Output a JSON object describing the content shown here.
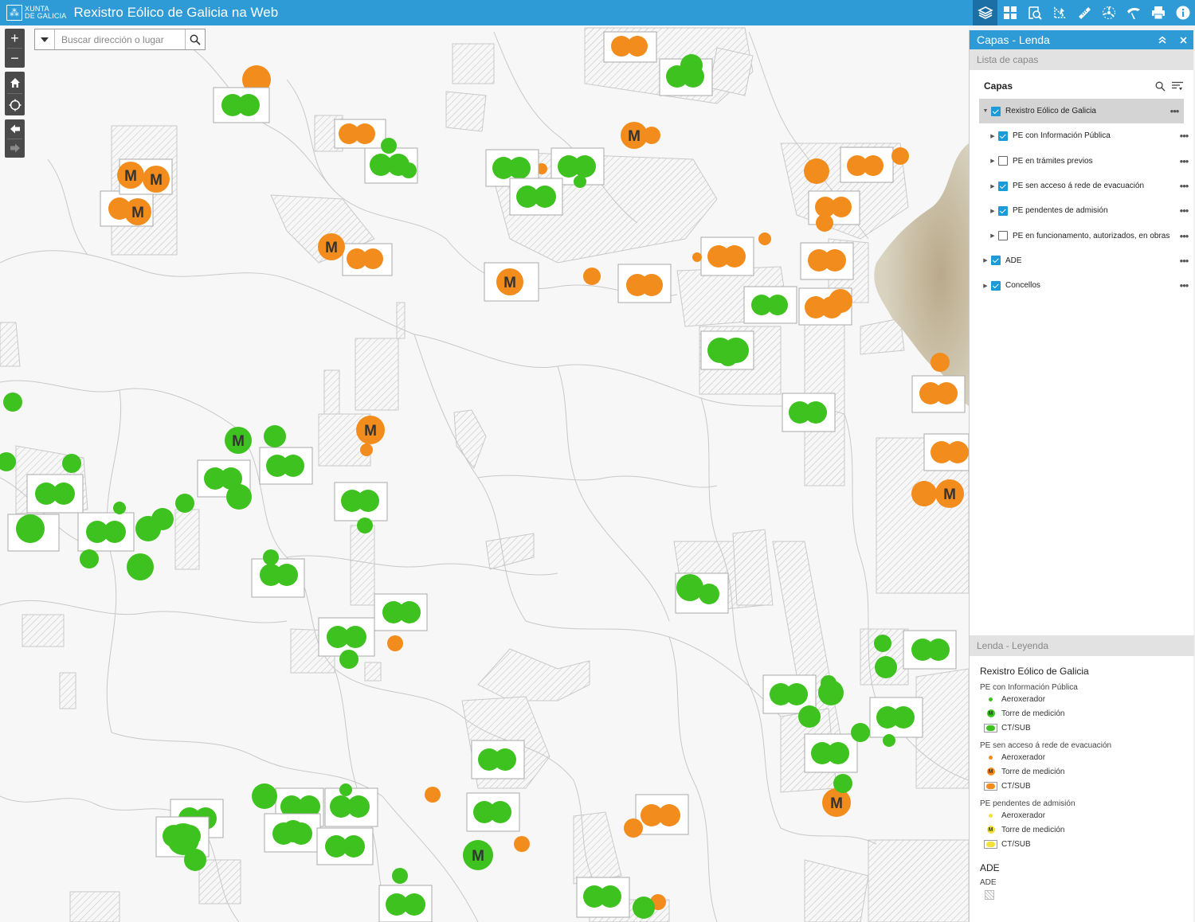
{
  "header": {
    "logo_line1": "XUNTA",
    "logo_line2": "DE GALICIA",
    "title": "Rexistro Eólico de Galicia na Web",
    "tools": [
      {
        "name": "layers-tool",
        "icon": "layers-icon",
        "active": true
      },
      {
        "name": "basemap-tool",
        "icon": "grid-icon",
        "active": false
      },
      {
        "name": "query-tool",
        "icon": "query-icon",
        "active": false
      },
      {
        "name": "select-tool",
        "icon": "select-icon",
        "active": false
      },
      {
        "name": "measure-tool",
        "icon": "ruler-icon",
        "active": false
      },
      {
        "name": "wind-tool",
        "icon": "turbine-icon",
        "active": false
      },
      {
        "name": "draw-tool",
        "icon": "draw-icon",
        "active": false
      },
      {
        "name": "print-tool",
        "icon": "print-icon",
        "active": false
      },
      {
        "name": "info-tool",
        "icon": "info-icon",
        "active": false
      }
    ]
  },
  "map_controls": {
    "zoom_in": "+",
    "zoom_out": "−"
  },
  "search": {
    "placeholder": "Buscar dirección o lugar"
  },
  "panel": {
    "title": "Capas - Lenda",
    "layer_list_title": "Lista de capas",
    "layers_header": "Capas",
    "layers": [
      {
        "label": "Rexistro Eólico de Galicia",
        "checked": true,
        "level": 0,
        "selected": true,
        "expanded": true
      },
      {
        "label": "PE con Información Pública",
        "checked": true,
        "level": 1,
        "selected": false
      },
      {
        "label": "PE en trámites previos",
        "checked": false,
        "level": 1,
        "selected": false
      },
      {
        "label": "PE sen acceso á rede de evacuación",
        "checked": true,
        "level": 1,
        "selected": false
      },
      {
        "label": "PE pendentes de admisión",
        "checked": true,
        "level": 1,
        "selected": false
      },
      {
        "label": "PE en funcionamento, autorizados, en obras",
        "checked": false,
        "level": 1,
        "selected": false
      },
      {
        "label": "ADE",
        "checked": true,
        "level": 0,
        "selected": false
      },
      {
        "label": "Concellos",
        "checked": true,
        "level": 0,
        "selected": false
      }
    ],
    "legend_title": "Lenda - Leyenda",
    "legend": {
      "group_title": "Rexistro Eólico de Galicia",
      "sections": [
        {
          "title": "PE con Información Pública",
          "color": "#3ec21f",
          "items": [
            "Aeroxerador",
            "Torre de medición",
            "CT/SUB"
          ]
        },
        {
          "title": "PE sen acceso á rede de evacuación",
          "color": "#f28c1c",
          "items": [
            "Aeroxerador",
            "Torre de medición",
            "CT/SUB"
          ]
        },
        {
          "title": "PE pendentes de admisión",
          "color": "#f2e23a",
          "items": [
            "Aeroxerador",
            "Torre de medición",
            "CT/SUB"
          ]
        }
      ],
      "ade_title": "ADE",
      "ade_item": "ADE",
      "tower_letter": "M"
    }
  },
  "colors": {
    "header": "#2e9bd6",
    "green": "#3ec21f",
    "orange": "#f28c1c",
    "yellow": "#f2e23a"
  }
}
